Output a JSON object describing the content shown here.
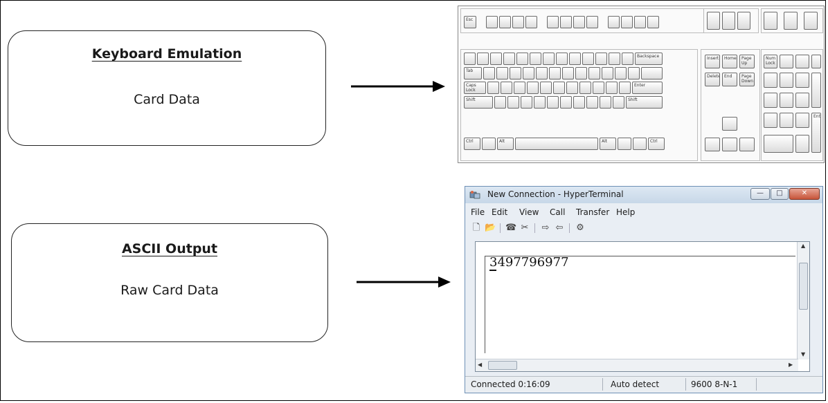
{
  "emulation_box": {
    "title": "Keyboard Emulation",
    "subtitle": "Card Data"
  },
  "ascii_box": {
    "title": "ASCII Output",
    "subtitle": "Raw Card Data"
  },
  "keyboard": {
    "esc": "Esc",
    "backspace": "Backspace",
    "enter": "Enter",
    "shift": "Shift",
    "ctrl": "Ctrl",
    "alt": "Alt",
    "tab": "Tab",
    "caps": "Caps Lock",
    "insert": "Insert",
    "home": "Home",
    "page_up": "Page Up",
    "delete": "Delete",
    "end": "End",
    "page_down": "Page Down",
    "num_lock": "Num Lock",
    "keypad_enter": "Enter"
  },
  "hyperterminal": {
    "title": "New Connection - HyperTerminal",
    "menu": [
      "File",
      "Edit",
      "View",
      "Call",
      "Transfer",
      "Help"
    ],
    "output": "3497796977",
    "status": {
      "connected": "Connected 0:16:09",
      "detect": "Auto detect",
      "settings": "9600 8-N-1"
    }
  },
  "colors": {
    "border": "#222222",
    "titlebar": "#c7d7e8",
    "close": "#c75439"
  }
}
